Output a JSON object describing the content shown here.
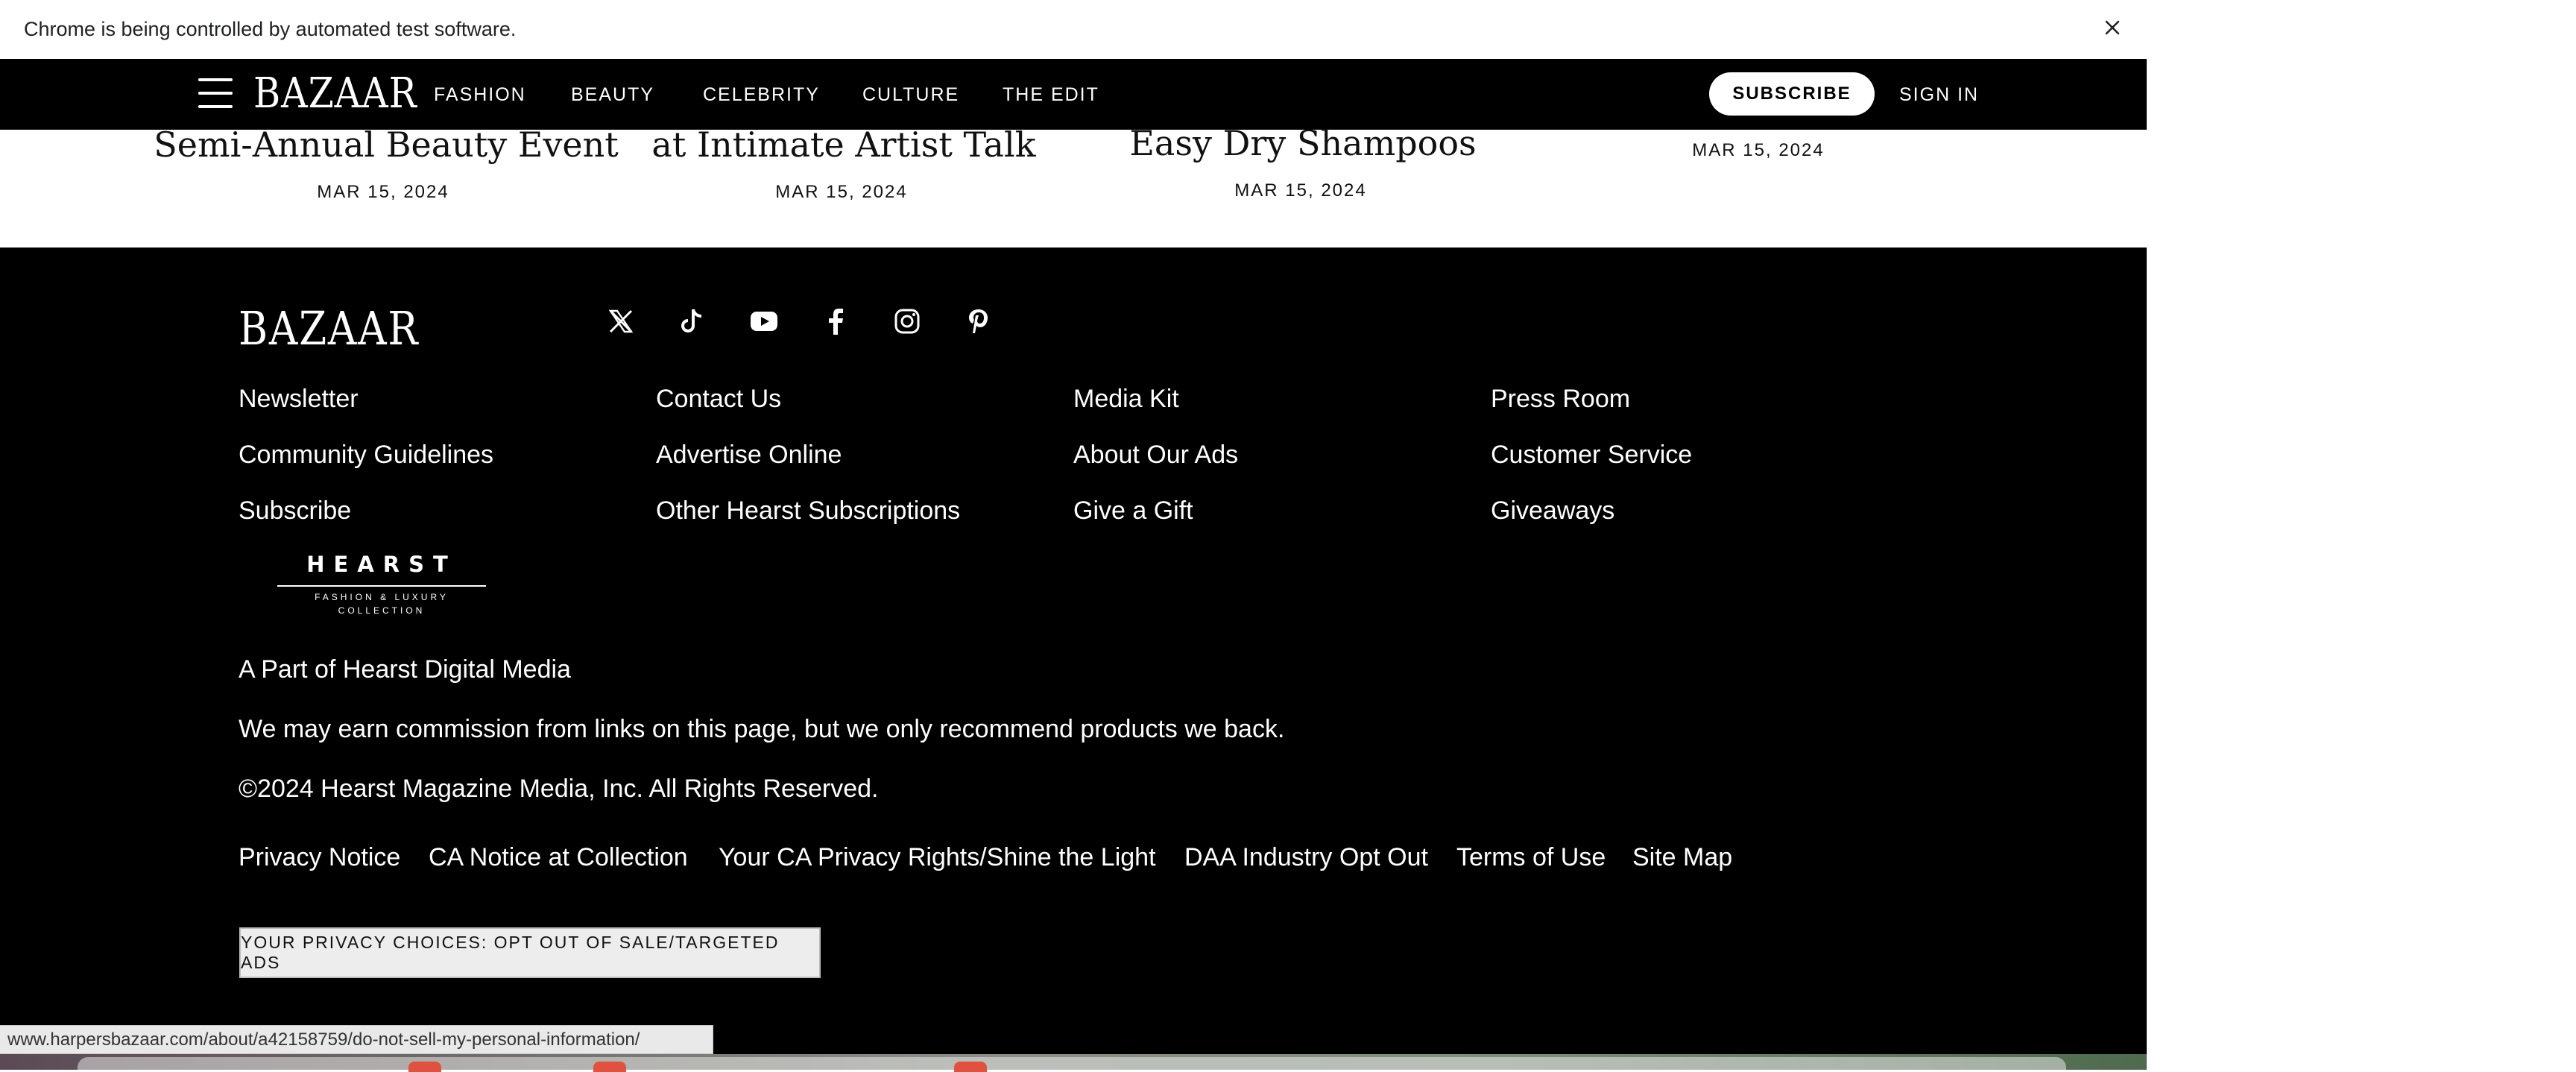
{
  "infobar": {
    "message": "Chrome is being controlled by automated test software.",
    "close_icon": "close-icon"
  },
  "header": {
    "logo": "BAZAAR",
    "nav": [
      "FASHION",
      "BEAUTY",
      "CELEBRITY",
      "CULTURE",
      "THE EDIT"
    ],
    "subscribe_label": "SUBSCRIBE",
    "signin_label": "SIGN IN"
  },
  "articles": [
    {
      "title": "Semi-Annual Beauty Event",
      "date": "MAR 15, 2024"
    },
    {
      "title": "at Intimate Artist Talk",
      "date": "MAR 15, 2024"
    },
    {
      "title": "Easy Dry Shampoos",
      "date": "MAR 15, 2024"
    },
    {
      "title": "",
      "date": "MAR 15, 2024"
    }
  ],
  "footer": {
    "logo": "BAZAAR",
    "social_icons": [
      "x-icon",
      "tiktok-icon",
      "youtube-icon",
      "facebook-icon",
      "instagram-icon",
      "pinterest-icon"
    ],
    "link_columns": [
      [
        "Newsletter",
        "Community Guidelines",
        "Subscribe"
      ],
      [
        "Contact Us",
        "Advertise Online",
        "Other Hearst Subscriptions"
      ],
      [
        "Media Kit",
        "About Our Ads",
        "Give a Gift"
      ],
      [
        "Press Room",
        "Customer Service",
        "Giveaways"
      ]
    ],
    "hearst_logo": {
      "word": "HEARST",
      "line1": "FASHION & LUXURY",
      "line2": "COLLECTION"
    },
    "part_of": "A Part of Hearst Digital Media",
    "commission": "We may earn commission from links on this page, but we only recommend products we back.",
    "copyright": "©2024 Hearst Magazine Media, Inc. All Rights Reserved.",
    "legal_links": [
      "Privacy Notice",
      "CA Notice at Collection",
      "Your CA Privacy Rights/Shine the Light",
      "DAA Industry Opt Out",
      "Terms of Use",
      "Site Map"
    ],
    "privacy_choices": "YOUR PRIVACY CHOICES: OPT OUT OF SALE/TARGETED ADS"
  },
  "status_url": "www.harpersbazaar.com/about/a42158759/do-not-sell-my-personal-information/"
}
